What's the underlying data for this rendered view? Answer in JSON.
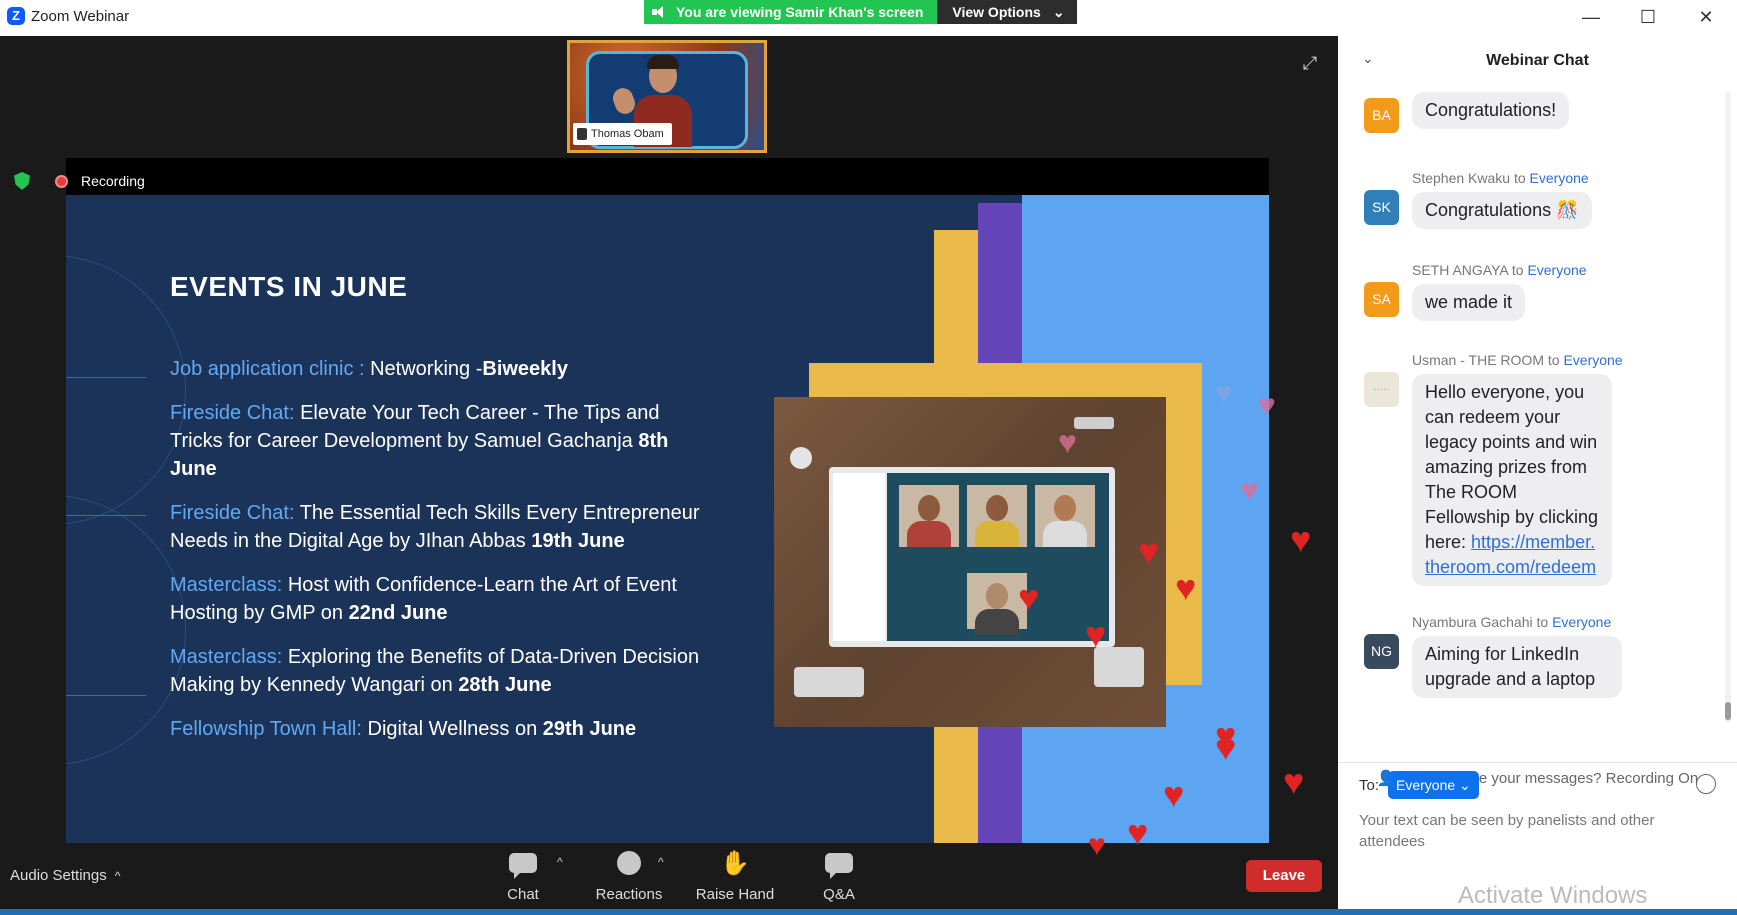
{
  "window": {
    "title": "Zoom Webinar",
    "controls": [
      "—",
      "☐",
      "✕"
    ]
  },
  "share_bar": {
    "message": "You are viewing Samir Khan's screen",
    "view_options": "View Options"
  },
  "video_thumb": {
    "name": "Thomas Obam"
  },
  "status": {
    "recording_label": "Recording"
  },
  "slide": {
    "title": "EVENTS IN JUNE",
    "events": [
      {
        "tag": "Job application clinic : ",
        "text": "Networking -",
        "bold": "Biweekly"
      },
      {
        "tag": "Fireside Chat: ",
        "text": "Elevate Your Tech Career - The Tips and Tricks for Career Development by Samuel Gachanja ",
        "bold": "8th June"
      },
      {
        "tag": "Fireside Chat: ",
        "text": "The Essential Tech Skills Every Entrepreneur Needs in the Digital Age  by JIhan Abbas ",
        "bold": "19th June"
      },
      {
        "tag": "Masterclass: ",
        "text": "Host with Confidence-Learn the Art of Event Hosting by GMP on ",
        "bold": "22nd June"
      },
      {
        "tag": "Masterclass: ",
        "text": "Exploring the Benefits of Data-Driven Decision Making by Kennedy Wangari on ",
        "bold": "28th June"
      },
      {
        "tag": "Fellowship Town Hall: ",
        "text": "Digital Wellness on ",
        "bold": "29th June"
      }
    ]
  },
  "toolbar": {
    "audio_settings": "Audio Settings",
    "chat": "Chat",
    "reactions": "Reactions",
    "raise_hand": "Raise Hand",
    "qa": "Q&A",
    "leave": "Leave"
  },
  "chat": {
    "title": "Webinar Chat",
    "messages": [
      {
        "initials": "BA",
        "color": "#f29a1a",
        "sender": "",
        "recipient": "",
        "text": "Congratulations!"
      },
      {
        "initials": "SK",
        "color": "#2f7fb8",
        "sender": "Stephen Kwaku",
        "recipient": "Everyone",
        "text": "Congratulations 🎊"
      },
      {
        "initials": "SA",
        "color": "#f29a1a",
        "sender": "SETH ANGAYA",
        "recipient": "Everyone",
        "text": "we made it"
      },
      {
        "initials": "·····",
        "color": "#ebe6da",
        "sender": "Usman - THE ROOM",
        "recipient": "Everyone",
        "text": "Hello everyone, you can redeem your legacy points and win amazing prizes from The ROOM Fellowship by clicking here:",
        "link": "https://member.theroom.com/redeem"
      },
      {
        "initials": "NG",
        "color": "#3a4a5e",
        "sender": "Nyambura Gachahi",
        "recipient": "Everyone",
        "text": "Aiming for LinkedIn upgrade and a laptop"
      }
    ],
    "to_word": "to",
    "visibility_note": "Who can see your messages? Recording On",
    "to_label": "To:",
    "recipient": "Everyone",
    "placeholder": "Your text can be seen by panelists and other attendees",
    "watermark": "Activate Windows"
  }
}
